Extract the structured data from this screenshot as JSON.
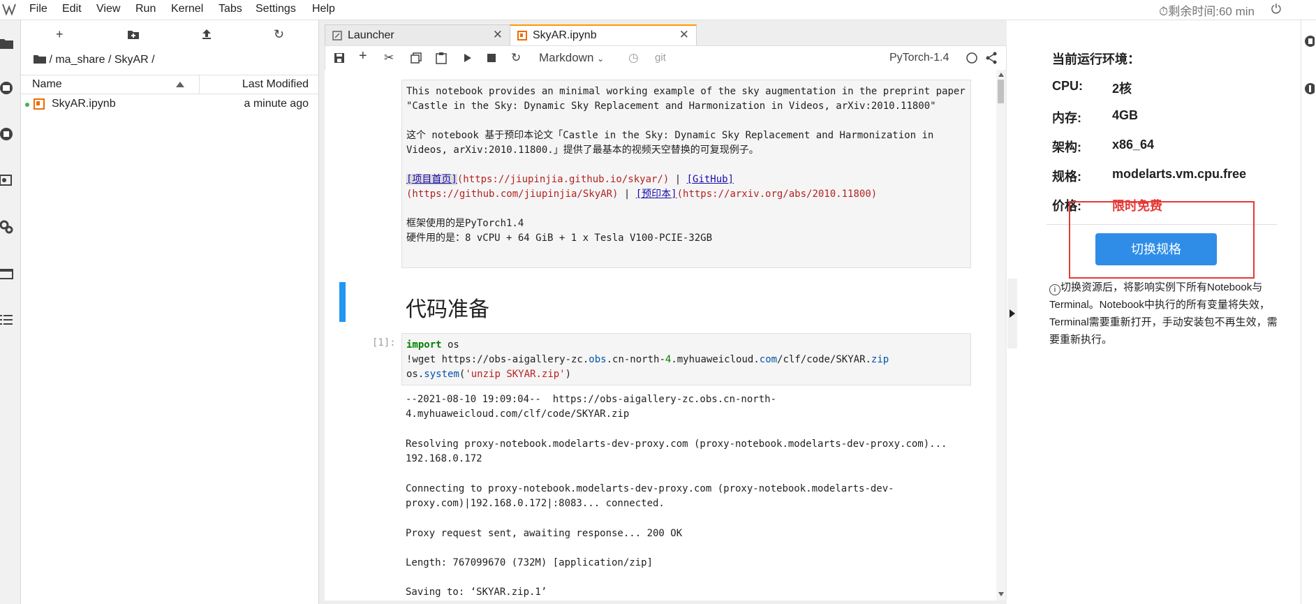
{
  "menubar": {
    "items": [
      "File",
      "Edit",
      "View",
      "Run",
      "Kernel",
      "Tabs",
      "Settings",
      "Help"
    ],
    "timer": "剩余时间:60 min"
  },
  "activity_icons": [
    "folder-icon",
    "running-icon",
    "stop-icon",
    "commands-icon",
    "settings-icon",
    "tabs-icon",
    "list-icon"
  ],
  "filebrowser": {
    "breadcrumb": "/ ma_share / SkyAR /",
    "col_name": "Name",
    "col_modified": "Last Modified",
    "file_name": "SkyAR.ipynb",
    "file_modified": "a minute ago"
  },
  "tabs": [
    {
      "label": "Launcher"
    },
    {
      "label": "SkyAR.ipynb"
    }
  ],
  "toolbar": {
    "cell_type": "Markdown",
    "git": "git",
    "kernel": "PyTorch-1.4"
  },
  "notebook": {
    "md1_line1": "This notebook provides an minimal working example of the sky augmentation in the preprint paper \"Castle in the Sky: Dynamic Sky Replacement and Harmonization in Videos, arXiv:2010.11800\"",
    "md1_line2": "这个 notebook 基于预印本论文「Castle in the Sky: Dynamic Sky Replacement and Harmonization in Videos, arXiv:2010.11800.」提供了最基本的视频天空替换的可复现例子。",
    "link1_text": "[项目首页]",
    "link1_url": "(https://jiupinjia.github.io/skyar/)",
    "sep": " | ",
    "link2_text": "[GitHub]",
    "link2_url": "(https://github.com/jiupinjia/SkyAR)",
    "link3_text": "[预印本]",
    "link3_url": "(https://arxiv.org/abs/2010.11800)",
    "framework": "框架使用的是PyTorch1.4",
    "hardware": "硬件用的是：8 vCPU + 64 GiB + 1 x Tesla V100-PCIE-32GB",
    "heading": "代码准备",
    "prompt": "[1]:",
    "code_import_kw": "import",
    "code_import_rest": " os",
    "code_wget_pre": "!wget https://obs-aigallery-zc.",
    "code_wget_obs": "obs",
    "code_wget_mid1": ".cn-north-",
    "code_wget_4": "4",
    "code_wget_mid2": ".myhuaweicloud.",
    "code_wget_com": "com",
    "code_wget_mid3": "/clf/code/SKYAR.",
    "code_wget_zip": "zip",
    "code_os": "os.",
    "code_system": "system",
    "code_paren_open": "(",
    "code_str": "'unzip SKYAR.zip'",
    "code_paren_close": ")",
    "out1": "--2021-08-10 19:09:04--  https://obs-aigallery-zc.obs.cn-north-4.myhuaweicloud.com/clf/code/SKYAR.zip",
    "out2": "Resolving proxy-notebook.modelarts-dev-proxy.com (proxy-notebook.modelarts-dev-proxy.com)... 192.168.0.172",
    "out3": "Connecting to proxy-notebook.modelarts-dev-proxy.com (proxy-notebook.modelarts-dev-proxy.com)|192.168.0.172|:8083... connected.",
    "out4": "Proxy request sent, awaiting response... 200 OK",
    "out5": "Length: 767099670 (732M) [application/zip]",
    "out6": "Saving to: ‘SKYAR.zip.1’"
  },
  "rightpanel": {
    "title": "当前运行环境：",
    "cpu_label": "CPU:",
    "cpu_value": "2核",
    "mem_label": "内存:",
    "mem_value": "4GB",
    "arch_label": "架构:",
    "arch_value": "x86_64",
    "spec_label": "规格:",
    "spec_value": "modelarts.vm.cpu.free",
    "price_label": "价格:",
    "price_value": "限时免费",
    "price_color": "#e53935",
    "button": "切换规格",
    "note": "切换资源后，将影响实例下所有Notebook与Terminal。Notebook中执行的所有变量将失效，Terminal需要重新打开，手动安装包不再生效，需要重新执行。"
  },
  "colors": {
    "accent": "#2f8de8",
    "tab_active": "#ff9800",
    "highlight": "#e53935"
  }
}
